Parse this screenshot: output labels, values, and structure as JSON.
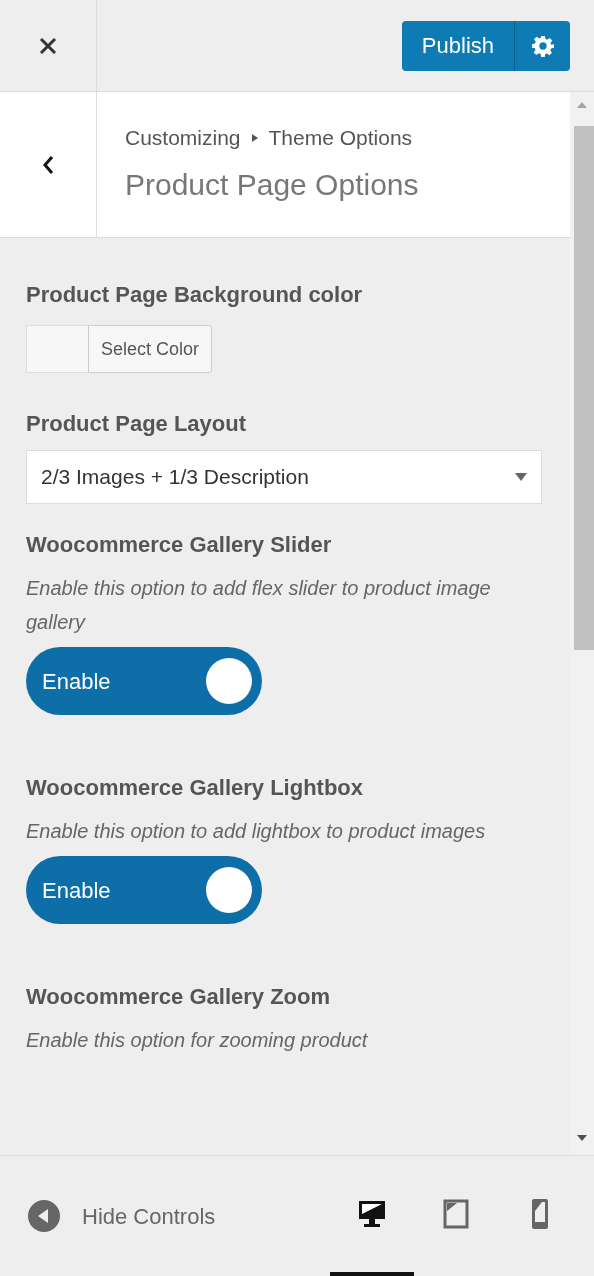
{
  "header": {
    "publish_label": "Publish"
  },
  "section": {
    "breadcrumb": [
      "Customizing",
      "Theme Options"
    ],
    "title": "Product Page Options"
  },
  "controls": [
    {
      "kind": "color",
      "label": "Product Page Background color",
      "button": "Select Color"
    },
    {
      "kind": "select",
      "label": "Product Page Layout",
      "value": "2/3 Images + 1/3 Description"
    },
    {
      "kind": "toggle",
      "label": "Woocommerce Gallery Slider",
      "description": "Enable this option to add flex slider to product image gallery",
      "on": true,
      "state_label": "Enable"
    },
    {
      "kind": "toggle",
      "label": "Woocommerce Gallery Lightbox",
      "description": "Enable this option to add lightbox to product images",
      "on": true,
      "state_label": "Enable"
    },
    {
      "kind": "toggle",
      "label": "Woocommerce Gallery Zoom",
      "description": "Enable this option for zooming product"
    }
  ],
  "footer": {
    "hide_label": "Hide Controls",
    "devices": [
      {
        "kind": "desktop",
        "selected": true
      },
      {
        "kind": "tablet",
        "selected": false
      },
      {
        "kind": "mobile",
        "selected": false
      }
    ]
  }
}
